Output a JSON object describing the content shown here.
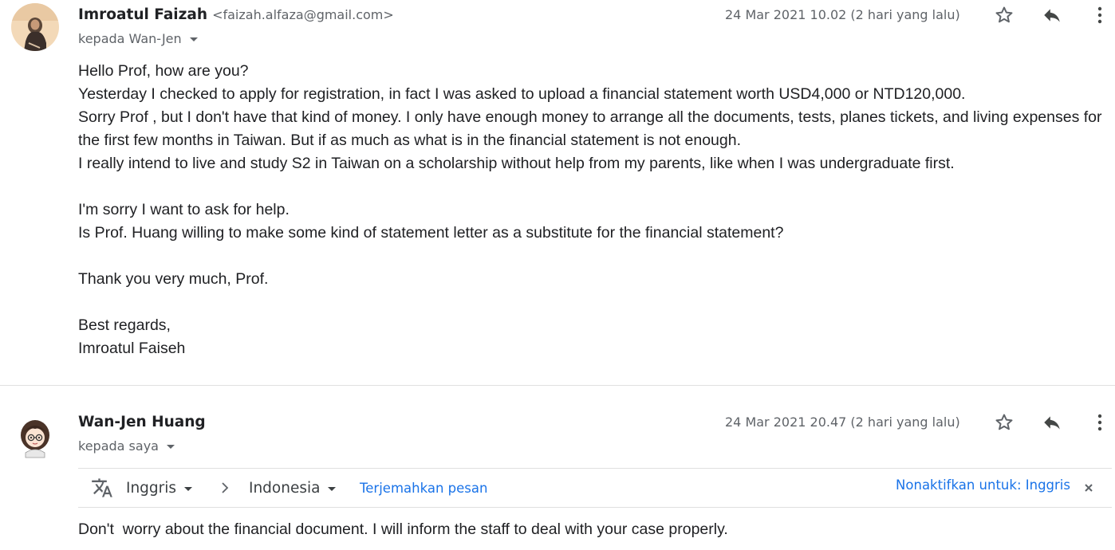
{
  "messages": [
    {
      "sender_name": "Imroatul Faizah",
      "sender_email": "<faizah.alfaza@gmail.com>",
      "recipient": "kepada Wan-Jen",
      "date": "24 Mar 2021 10.02 (2 hari yang lalu)",
      "body_lines": [
        "Hello Prof, how are you?",
        "Yesterday I checked to apply for registration, in fact I was asked to upload a financial statement worth USD4,000 or NTD120,000.",
        "Sorry Prof , but I don't have that kind of money. I only have enough money to arrange all the documents, tests, planes tickets, and living expenses for",
        "the first few months in Taiwan. But if as much as what is in the financial statement is not enough.",
        "I really intend to live and study S2 in Taiwan on a scholarship without help from my parents, like when I was undergraduate first.",
        "",
        "I'm sorry I want to ask for help.",
        "Is Prof. Huang willing to make some kind of statement letter as a substitute for the financial statement?",
        "",
        "Thank you very much, Prof.",
        "",
        "Best regards,",
        "Imroatul Faiseh"
      ]
    },
    {
      "sender_name": "Wan-Jen Huang",
      "recipient": "kepada saya",
      "date": "24 Mar 2021 20.47 (2 hari yang lalu)",
      "body_lines": [
        "Don't  worry about the financial document. I will inform the staff to deal with your case properly."
      ]
    }
  ],
  "translate_bar": {
    "source_lang": "Inggris",
    "target_lang": "Indonesia",
    "translate_link": "Terjemahkan pesan",
    "disable_link": "Nonaktifkan untuk: Inggris"
  },
  "icons": {
    "star": "star-icon",
    "reply": "reply-icon",
    "more": "more-vert-icon",
    "translate": "translate-icon",
    "chevron": "chevron-right-icon",
    "close": "close-icon"
  },
  "colors": {
    "text": "#202124",
    "muted": "#5f6368",
    "link": "#1a73e8",
    "divider": "#e0e0e0"
  }
}
